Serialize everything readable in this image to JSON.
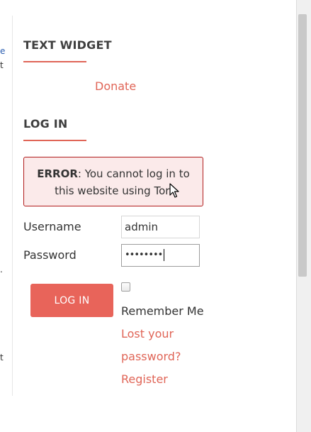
{
  "left_fragments": [
    "e",
    "t",
    ".",
    "t"
  ],
  "widgets": {
    "text_widget": {
      "title": "TEXT WIDGET",
      "donate_link": "Donate"
    },
    "login": {
      "title": "LOG IN",
      "error": {
        "label": "ERROR",
        "message": ": You cannot log in to this website using Tor."
      },
      "username_label": "Username",
      "username_value": "admin",
      "password_label": "Password",
      "password_value": "••••••••",
      "login_button": "LOG IN",
      "remember_me": "Remember Me",
      "lost_password_line1": "Lost your",
      "lost_password_line2": "password?",
      "register_link": "Register"
    }
  },
  "colors": {
    "accent": "#e06557",
    "button": "#e8645a",
    "error_border": "#b11b1b",
    "error_background": "#fbeaea"
  },
  "icons": {
    "cursor": "mouse-pointer-icon"
  }
}
